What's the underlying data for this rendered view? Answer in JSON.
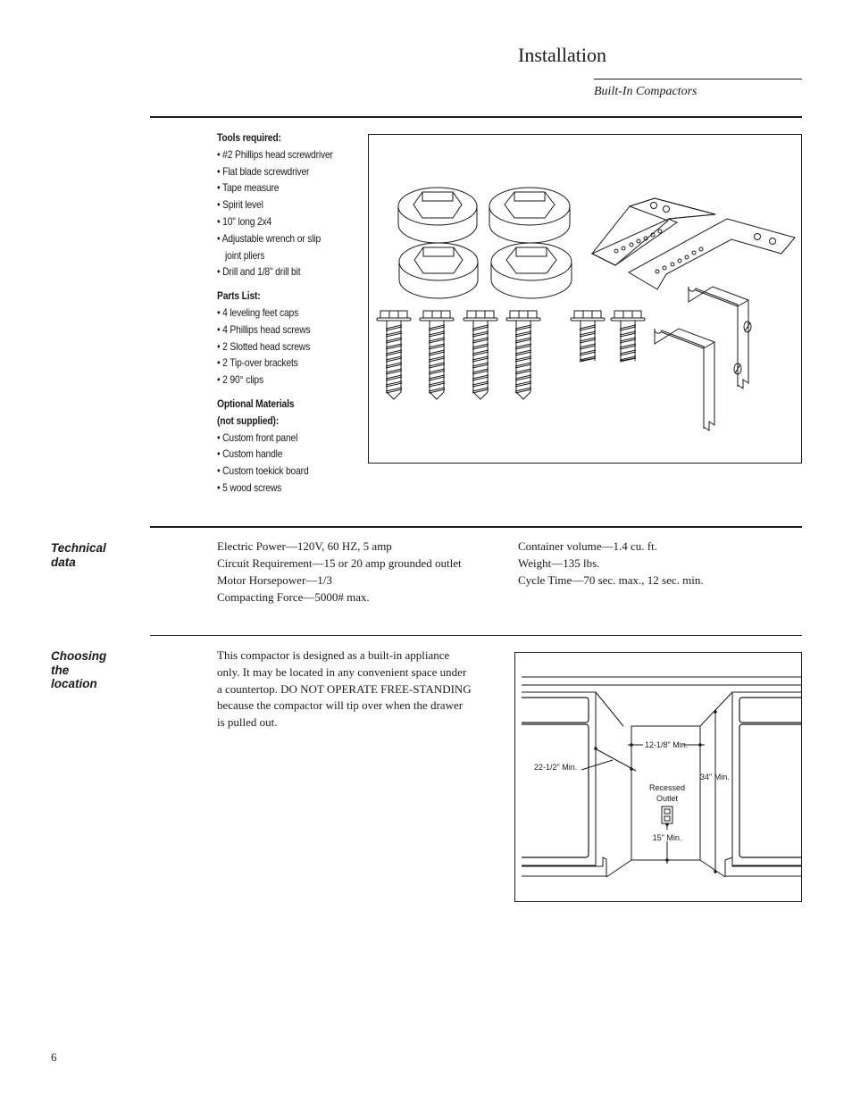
{
  "header": {
    "title": "Installation",
    "subtitle": "Built-In Compactors"
  },
  "tools": {
    "heading": "Tools required:",
    "items": [
      "#2 Phillips head screwdriver",
      " Flat blade screwdriver",
      "Tape measure",
      "Spirit level",
      "10\" long 2x4",
      "Adjustable wrench or slip",
      "joint pliers",
      "Drill and 1/8\" drill bit"
    ]
  },
  "parts": {
    "heading": "Parts List:",
    "items": [
      "4 leveling feet caps",
      "4 Phillips head screws",
      " 2 Slotted head screws",
      "2 Tip-over brackets",
      "2 90° clips"
    ]
  },
  "optional": {
    "heading_line1": "Optional Materials",
    "heading_line2": "(not supplied):",
    "items": [
      "Custom front panel",
      " Custom handle",
      "Custom toekick board",
      "5 wood screws"
    ]
  },
  "bullet": "•",
  "parts_figure": {
    "label": "parts-illustration",
    "parts": [
      "leveling-feet-cap",
      "leveling-feet-cap",
      "leveling-feet-cap",
      "leveling-feet-cap",
      "phillips-head-screw",
      "phillips-head-screw",
      "phillips-head-screw",
      "phillips-head-screw",
      "slotted-head-screw",
      "slotted-head-screw",
      "tip-over-bracket",
      "tip-over-bracket",
      "90-degree-clip",
      "90-degree-clip"
    ]
  },
  "technical": {
    "heading_line1": "Technical",
    "heading_line2": "data",
    "left": [
      "Electric Power—120V, 60 HZ, 5 amp",
      "Circuit Requirement—15 or 20 amp grounded outlet",
      "Motor Horsepower—1/3",
      "Compacting Force—5000# max."
    ],
    "right": [
      "Container volume—1.4 cu. ft.",
      "Weight—135 lbs.",
      "Cycle Time—70 sec. max., 12 sec. min."
    ]
  },
  "location": {
    "heading_line1": "Choosing",
    "heading_line2": "the",
    "heading_line3": "location",
    "paragraph_lines": [
      "This compactor is designed as a built-in appliance",
      "only. It may be located in any convenient space under",
      "a countertop. DO NOT OPERATE FREE-STANDING",
      "because the compactor will tip over when the drawer",
      "is pulled out."
    ],
    "diagram": {
      "width_label": "12-1/8\" Min.",
      "depth_label": "22-1/2\" Min.",
      "height_label": "34\" Min.",
      "outlet_label_line1": "Recessed",
      "outlet_label_line2": "Outlet",
      "outlet_height_label": "15\" Min."
    }
  },
  "footer": {
    "page_number": "6"
  }
}
